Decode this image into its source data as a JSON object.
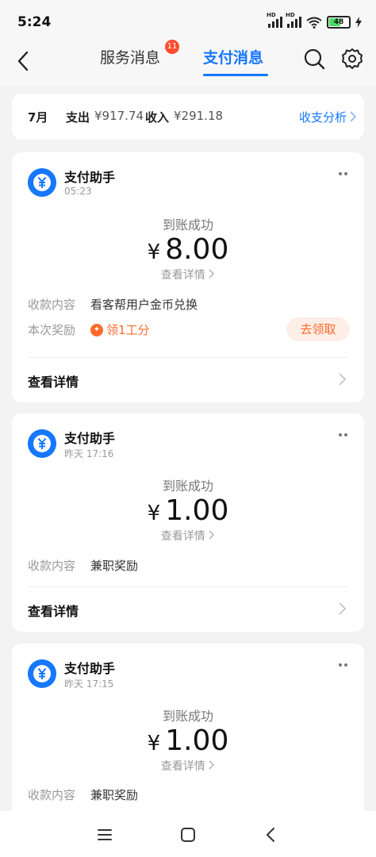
{
  "status_bar": {
    "time": "5:24",
    "hd1": "HD",
    "hd2": "HD",
    "battery": "48"
  },
  "header": {
    "tab_service": "服务消息",
    "service_badge": "11",
    "tab_pay": "支付消息",
    "accent": "#1677ff"
  },
  "summary": {
    "month": "7月",
    "out_label": "支出",
    "out_value": "¥917.74",
    "in_label": "收入",
    "in_value": "¥291.18",
    "analysis": "收支分析"
  },
  "cards": [
    {
      "sender": "支付助手",
      "time": "05:23",
      "status": "到账成功",
      "currency": "¥",
      "amount": "8.00",
      "view_details": "查看详情",
      "content_label": "收款内容",
      "content_value": "看客帮用户金币兑换",
      "reward_label": "本次奖励",
      "reward_value": "领1工分",
      "claim_button": "去领取",
      "footer": "查看详情"
    },
    {
      "sender": "支付助手",
      "time": "昨天 17:16",
      "status": "到账成功",
      "currency": "¥",
      "amount": "1.00",
      "view_details": "查看详情",
      "content_label": "收款内容",
      "content_value": "兼职奖励",
      "footer": "查看详情"
    },
    {
      "sender": "支付助手",
      "time": "昨天 17:15",
      "status": "到账成功",
      "currency": "¥",
      "amount": "1.00",
      "view_details": "查看详情",
      "content_label": "收款内容",
      "content_value": "兼职奖励"
    }
  ],
  "icons": {
    "back": "back-arrow-icon",
    "search": "search-icon",
    "settings": "gear-icon",
    "avatar": "yuan-icon",
    "more": "more-dots-icon",
    "chevron": "chevron-right-icon",
    "nav_menu": "menu-icon",
    "nav_home": "home-square-icon",
    "nav_back": "nav-back-icon"
  }
}
